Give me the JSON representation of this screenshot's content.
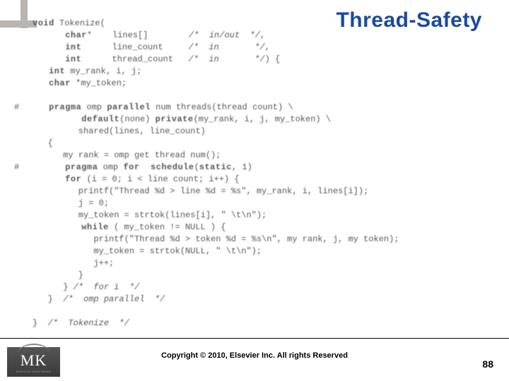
{
  "title": "Thread-Safety",
  "code": {
    "l01a": "void",
    "l01b": " Tokenize(",
    "l02a": "      char",
    "l02b": "*    lines[]        ",
    "l02c": "/*  in/out  */",
    "l02d": ",",
    "l03a": "      int",
    "l03b": "      line_count     ",
    "l03c": "/*  in       */",
    "l03d": ",",
    "l04a": "      int",
    "l04b": "      thread_count   ",
    "l04c": "/*  in       */",
    "l04d": ") {",
    "l05a": "   int",
    "l05b": " my_rank, i, j;",
    "l06a": "   char",
    "l06b": " *my_token;",
    "l07": " ",
    "l08h": "#",
    "l08a": "   pragma",
    "l08b": " omp ",
    "l08c": "parallel",
    "l08d": " num threads(thread count) \\",
    "l09a": "         default",
    "l09b": "(none) ",
    "l09c": "private",
    "l09d": "(my_rank, i, j, my_token) \\",
    "l10a": "         shared(lines, line_count)",
    "l11": "   {",
    "l12": "      my rank = omp get thread num();",
    "l13h": "#",
    "l13a": "      pragma",
    "l13b": " omp ",
    "l13c": "for  schedule",
    "l13d": "(",
    "l13e": "static",
    "l13f": ", 1)",
    "l14a": "      for",
    "l14b": " (i = 0; i < line count; i++) {",
    "l15": "         printf(\"Thread %d > line %d = %s\", my_rank, i, lines[i]);",
    "l16": "         j = 0;",
    "l17": "         my_token = strtok(lines[i], \" \\t\\n\");",
    "l18a": "         while",
    "l18b": " ( my_token != NULL ) {",
    "l19": "            printf(\"Thread %d > token %d = %s\\n\", my rank, j, my token);",
    "l20": "            my_token = strtok(NULL, \" \\t\\n\");",
    "l21": "            j++;",
    "l22": "         }",
    "l23a": "      } ",
    "l23b": "/*  for i  */",
    "l24a": "   }  ",
    "l24b": "/*  omp parallel  */",
    "l25": " ",
    "l26a": "}  ",
    "l26b": "/*  Tokenize  */"
  },
  "footer": {
    "copyright": "Copyright © 2010, Elsevier Inc. All rights Reserved",
    "page": "88",
    "logo_main": "MK",
    "logo_sub": "MORGAN KAUFMANN"
  }
}
